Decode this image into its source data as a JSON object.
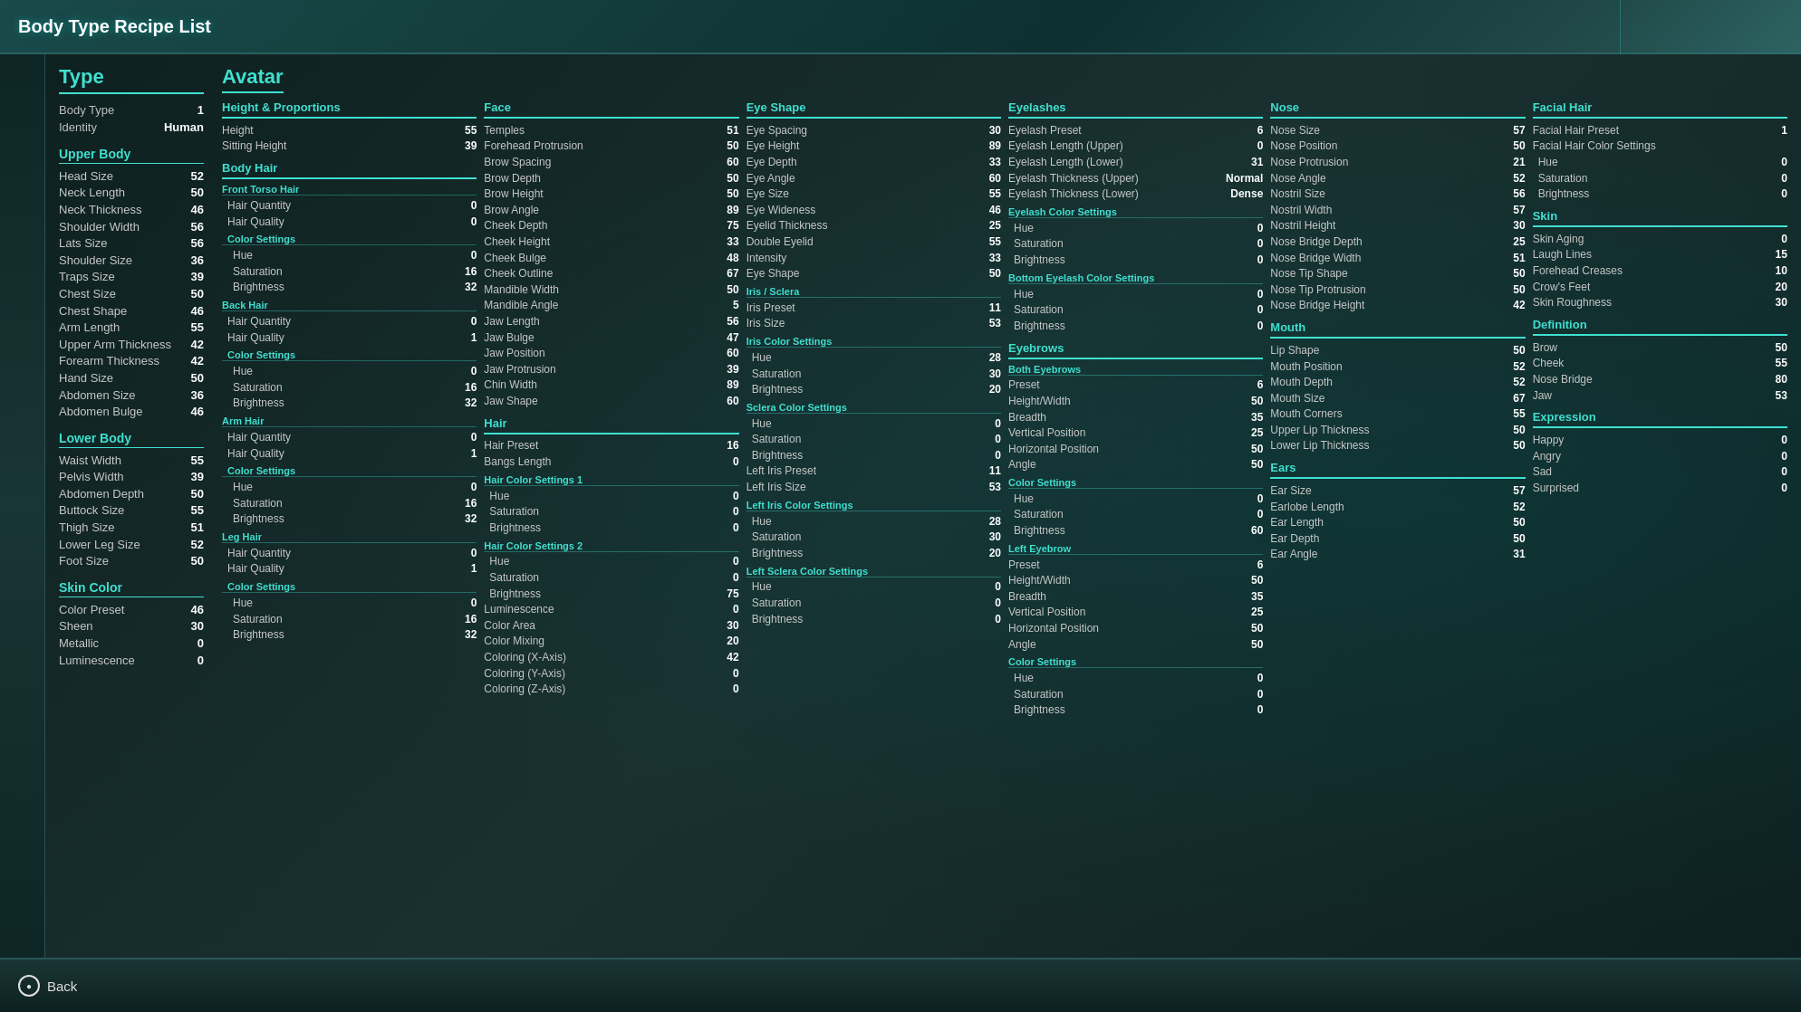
{
  "title": "Body Type Recipe List",
  "back_button": "Back",
  "type_section": {
    "title": "Type",
    "body_type_label": "Body Type",
    "body_type_value": "1",
    "identity_label": "Identity",
    "identity_value": "Human"
  },
  "avatar_title": "Avatar",
  "height_proportions": {
    "header": "Height & Proportions",
    "rows": [
      {
        "label": "Height",
        "value": "55"
      },
      {
        "label": "Sitting Height",
        "value": "39"
      }
    ]
  },
  "upper_body": {
    "header": "Upper Body",
    "rows": [
      {
        "label": "Head Size",
        "value": "52"
      },
      {
        "label": "Neck Length",
        "value": "50"
      },
      {
        "label": "Neck Thickness",
        "value": "46"
      },
      {
        "label": "Shoulder Width",
        "value": "56"
      },
      {
        "label": "Lats Size",
        "value": "56"
      },
      {
        "label": "Shoulder Size",
        "value": "36"
      },
      {
        "label": "Traps Size",
        "value": "39"
      },
      {
        "label": "Chest Size",
        "value": "50"
      },
      {
        "label": "Chest Shape",
        "value": "46"
      },
      {
        "label": "Arm Length",
        "value": "55"
      },
      {
        "label": "Upper Arm Thickness",
        "value": "42"
      },
      {
        "label": "Forearm Thickness",
        "value": "42"
      },
      {
        "label": "Hand Size",
        "value": "50"
      },
      {
        "label": "Abdomen Size",
        "value": "36"
      },
      {
        "label": "Abdomen Bulge",
        "value": "46"
      }
    ]
  },
  "lower_body": {
    "header": "Lower Body",
    "rows": [
      {
        "label": "Waist Width",
        "value": "55"
      },
      {
        "label": "Pelvis Width",
        "value": "39"
      },
      {
        "label": "Abdomen Depth",
        "value": "50"
      },
      {
        "label": "Buttock Size",
        "value": "55"
      },
      {
        "label": "Thigh Size",
        "value": "51"
      },
      {
        "label": "Lower Leg Size",
        "value": "52"
      },
      {
        "label": "Foot Size",
        "value": "50"
      }
    ]
  },
  "skin_color": {
    "header": "Skin Color",
    "rows": [
      {
        "label": "Color Preset",
        "value": "46"
      },
      {
        "label": "Sheen",
        "value": "30"
      },
      {
        "label": "Metallic",
        "value": "0"
      },
      {
        "label": "Luminescence",
        "value": "0"
      }
    ]
  },
  "body_hair": {
    "header": "Body Hair",
    "front_torso": {
      "label": "Front Torso Hair",
      "value": ""
    },
    "front_quantity": {
      "label": "Hair Quantity",
      "value": "0"
    },
    "front_quality": {
      "label": "Hair Quality",
      "value": "0"
    },
    "color_settings1": "Color Settings",
    "hue1": {
      "label": "Hue",
      "value": "0"
    },
    "sat1": {
      "label": "Saturation",
      "value": "16"
    },
    "bri1": {
      "label": "Brightness",
      "value": "32"
    },
    "back_hair": "Back Hair",
    "back_quantity": {
      "label": "Hair Quantity",
      "value": "0"
    },
    "back_quality": {
      "label": "Hair Quality",
      "value": "1"
    },
    "color_settings2": "Color Settings",
    "hue2": {
      "label": "Hue",
      "value": "0"
    },
    "sat2": {
      "label": "Saturation",
      "value": "16"
    },
    "bri2": {
      "label": "Brightness",
      "value": "32"
    },
    "arm_hair": "Arm Hair",
    "arm_quantity": {
      "label": "Hair Quantity",
      "value": "0"
    },
    "arm_quality": {
      "label": "Hair Quality",
      "value": "1"
    },
    "color_settings3": "Color Settings",
    "hue3": {
      "label": "Hue",
      "value": "0"
    },
    "sat3": {
      "label": "Saturation",
      "value": "16"
    },
    "bri3": {
      "label": "Brightness",
      "value": "32"
    },
    "leg_hair": "Leg Hair",
    "leg_quantity": {
      "label": "Hair Quantity",
      "value": "0"
    },
    "leg_quality": {
      "label": "Hair Quality",
      "value": "1"
    },
    "color_settings4": "Color Settings",
    "hue4": {
      "label": "Hue",
      "value": "0"
    },
    "sat4": {
      "label": "Saturation",
      "value": "16"
    },
    "bri4": {
      "label": "Brightness",
      "value": "32"
    }
  },
  "face": {
    "header": "Face",
    "rows": [
      {
        "label": "Temples",
        "value": "51"
      },
      {
        "label": "Forehead Protrusion",
        "value": "50"
      },
      {
        "label": "Brow Spacing",
        "value": "60"
      },
      {
        "label": "Brow Depth",
        "value": "50"
      },
      {
        "label": "Brow Height",
        "value": "50"
      },
      {
        "label": "Brow Angle",
        "value": "89"
      },
      {
        "label": "Cheek Depth",
        "value": "75"
      },
      {
        "label": "Cheek Height",
        "value": "33"
      },
      {
        "label": "Cheek Bulge",
        "value": "48"
      },
      {
        "label": "Cheek Outline",
        "value": "67"
      },
      {
        "label": "Mandible Width",
        "value": "50"
      },
      {
        "label": "Mandible Angle",
        "value": "5"
      },
      {
        "label": "Jaw Length",
        "value": "56"
      },
      {
        "label": "Jaw Bulge",
        "value": "47"
      },
      {
        "label": "Jaw Position",
        "value": "60"
      },
      {
        "label": "Jaw Protrusion",
        "value": "39"
      },
      {
        "label": "Chin Width",
        "value": "89"
      },
      {
        "label": "Jaw Shape",
        "value": "60"
      }
    ]
  },
  "hair": {
    "header": "Hair",
    "rows": [
      {
        "label": "Hair Preset",
        "value": "16"
      },
      {
        "label": "Bangs Length",
        "value": "0"
      }
    ],
    "color1": "Hair Color Settings 1",
    "hue1": {
      "label": "Hue",
      "value": "0"
    },
    "sat1": {
      "label": "Saturation",
      "value": "0"
    },
    "bri1": {
      "label": "Brightness",
      "value": "0"
    },
    "color2": "Hair Color Settings 2",
    "hue2": {
      "label": "Hue",
      "value": "0"
    },
    "sat2": {
      "label": "Saturation",
      "value": "0"
    },
    "bri2": {
      "label": "Brightness",
      "value": "75"
    },
    "luminescence": {
      "label": "Luminescence",
      "value": "0"
    },
    "color_area": {
      "label": "Color Area",
      "value": "30"
    },
    "color_mixing": {
      "label": "Color Mixing",
      "value": "20"
    },
    "coloring_x": {
      "label": "Coloring (X-Axis)",
      "value": "42"
    },
    "coloring_y": {
      "label": "Coloring (Y-Axis)",
      "value": "0"
    },
    "coloring_z": {
      "label": "Coloring (Z-Axis)",
      "value": "0"
    }
  },
  "eye_shape": {
    "header": "Eye Shape",
    "rows": [
      {
        "label": "Eye Spacing",
        "value": "30"
      },
      {
        "label": "Eye Height",
        "value": "89"
      },
      {
        "label": "Eye Depth",
        "value": "33"
      },
      {
        "label": "Eye Angle",
        "value": "60"
      },
      {
        "label": "Eye Size",
        "value": "55"
      },
      {
        "label": "Eye Wideness",
        "value": "46"
      },
      {
        "label": "Eyelid Thickness",
        "value": "25"
      },
      {
        "label": "Double Eyelid",
        "value": "55"
      },
      {
        "label": "Intensity",
        "value": "33"
      },
      {
        "label": "Eye Shape",
        "value": "50"
      }
    ],
    "iris_sclera": "Iris / Sclera",
    "iris_rows": [
      {
        "label": "Iris Preset",
        "value": "11"
      },
      {
        "label": "Iris Size",
        "value": "53"
      }
    ],
    "iris_color": "Iris Color Settings",
    "iris_color_rows": [
      {
        "label": "Hue",
        "value": "28"
      },
      {
        "label": "Saturation",
        "value": "30"
      },
      {
        "label": "Brightness",
        "value": "20"
      }
    ],
    "sclera_color": "Sclera Color Settings",
    "sclera_rows": [
      {
        "label": "Hue",
        "value": "0"
      },
      {
        "label": "Saturation",
        "value": "0"
      },
      {
        "label": "Brightness",
        "value": "0"
      }
    ],
    "left_iris": {
      "label": "Left Iris Preset",
      "value": "11"
    },
    "left_iris_size": {
      "label": "Left Iris Size",
      "value": "53"
    },
    "left_iris_color": "Left Iris Color Settings",
    "left_iris_hue": {
      "label": "Hue",
      "value": "28"
    },
    "left_iris_sat": {
      "label": "Saturation",
      "value": "30"
    },
    "left_iris_bri": {
      "label": "Brightness",
      "value": "20"
    },
    "left_sclera": "Left Sclera Color Settings",
    "left_sclera_hue": {
      "label": "Hue",
      "value": "0"
    },
    "left_sclera_sat": {
      "label": "Saturation",
      "value": "0"
    },
    "left_sclera_bri": {
      "label": "Brightness",
      "value": "0"
    }
  },
  "eyelashes": {
    "header": "Eyelashes",
    "rows": [
      {
        "label": "Eyelash Preset",
        "value": "6"
      },
      {
        "label": "Eyelash Length (Upper)",
        "value": "0"
      },
      {
        "label": "Eyelash Length (Lower)",
        "value": "31"
      },
      {
        "label": "Eyelash Thickness (Upper)",
        "value": "Normal"
      },
      {
        "label": "Eyelash Thickness (Lower)",
        "value": "Dense"
      }
    ],
    "eyelash_color": "Eyelash Color Settings",
    "eyelash_color_rows": [
      {
        "label": "Hue",
        "value": "0"
      },
      {
        "label": "Saturation",
        "value": "0"
      },
      {
        "label": "Brightness",
        "value": "0"
      }
    ],
    "bottom_color": "Bottom Eyelash Color Settings",
    "bottom_rows": [
      {
        "label": "Hue",
        "value": "0"
      },
      {
        "label": "Saturation",
        "value": "0"
      },
      {
        "label": "Brightness",
        "value": "0"
      }
    ]
  },
  "eyebrows": {
    "header": "Eyebrows",
    "both_label": "Both Eyebrows",
    "rows": [
      {
        "label": "Preset",
        "value": "6"
      },
      {
        "label": "Height/Width",
        "value": "50"
      },
      {
        "label": "Breadth",
        "value": "35"
      },
      {
        "label": "Vertical Position",
        "value": "25"
      },
      {
        "label": "Horizontal Position",
        "value": "50"
      },
      {
        "label": "Angle",
        "value": "50"
      }
    ],
    "color": "Color Settings",
    "color_rows": [
      {
        "label": "Hue",
        "value": "0"
      },
      {
        "label": "Saturation",
        "value": "0"
      },
      {
        "label": "Brightness",
        "value": "60"
      }
    ],
    "left_label": "Left Eyebrow",
    "left_rows": [
      {
        "label": "Preset",
        "value": "6"
      },
      {
        "label": "Height/Width",
        "value": "50"
      },
      {
        "label": "Breadth",
        "value": "35"
      },
      {
        "label": "Vertical Position",
        "value": "25"
      },
      {
        "label": "Horizontal Position",
        "value": "50"
      },
      {
        "label": "Angle",
        "value": "50"
      }
    ],
    "left_color": "Color Settings",
    "left_color_rows": [
      {
        "label": "Hue",
        "value": "0"
      },
      {
        "label": "Saturation",
        "value": "0"
      },
      {
        "label": "Brightness",
        "value": "0"
      }
    ]
  },
  "nose": {
    "header": "Nose",
    "rows": [
      {
        "label": "Nose Size",
        "value": "57"
      },
      {
        "label": "Nose Position",
        "value": "50"
      },
      {
        "label": "Nose Protrusion",
        "value": "21"
      },
      {
        "label": "Nose Angle",
        "value": "52"
      },
      {
        "label": "Nostril Size",
        "value": "56"
      },
      {
        "label": "Nostril Width",
        "value": "57"
      },
      {
        "label": "Nostril Height",
        "value": "30"
      },
      {
        "label": "Nose Bridge Depth",
        "value": "25"
      },
      {
        "label": "Nose Bridge Width",
        "value": "51"
      },
      {
        "label": "Nose Tip Shape",
        "value": "50"
      },
      {
        "label": "Nose Tip Protrusion",
        "value": "50"
      },
      {
        "label": "Nose Bridge Height",
        "value": "42"
      }
    ]
  },
  "mouth": {
    "header": "Mouth",
    "rows": [
      {
        "label": "Lip Shape",
        "value": "50"
      },
      {
        "label": "Mouth Position",
        "value": "52"
      },
      {
        "label": "Mouth Depth",
        "value": "52"
      },
      {
        "label": "Mouth Size",
        "value": "67"
      },
      {
        "label": "Mouth Corners",
        "value": "55"
      },
      {
        "label": "Upper Lip Thickness",
        "value": "50"
      },
      {
        "label": "Lower Lip Thickness",
        "value": "50"
      }
    ]
  },
  "ears": {
    "header": "Ears",
    "rows": [
      {
        "label": "Ear Size",
        "value": "57"
      },
      {
        "label": "Earlobe Length",
        "value": "52"
      },
      {
        "label": "Ear Length",
        "value": "50"
      },
      {
        "label": "Ear Depth",
        "value": "50"
      },
      {
        "label": "Ear Angle",
        "value": "31"
      }
    ]
  },
  "facial_hair": {
    "header": "Facial Hair",
    "rows": [
      {
        "label": "Facial Hair Preset",
        "value": "1"
      },
      {
        "label": "Facial Hair Color Settings",
        "value": ""
      }
    ],
    "hue": {
      "label": "Hue",
      "value": "0"
    },
    "sat": {
      "label": "Saturation",
      "value": "0"
    },
    "bri": {
      "label": "Brightness",
      "value": "0"
    }
  },
  "skin": {
    "header": "Skin",
    "rows": [
      {
        "label": "Skin Aging",
        "value": "0"
      },
      {
        "label": "Laugh Lines",
        "value": "15"
      },
      {
        "label": "Forehead Creases",
        "value": "10"
      },
      {
        "label": "Crow's Feet",
        "value": "20"
      },
      {
        "label": "Skin Roughness",
        "value": "30"
      }
    ]
  },
  "definition": {
    "header": "Definition",
    "rows": [
      {
        "label": "Brow",
        "value": "50"
      },
      {
        "label": "Cheek",
        "value": "55"
      },
      {
        "label": "Nose Bridge",
        "value": "80"
      },
      {
        "label": "Jaw",
        "value": "53"
      }
    ]
  },
  "expression": {
    "header": "Expression",
    "rows": [
      {
        "label": "Happy",
        "value": "0"
      },
      {
        "label": "Angry",
        "value": "0"
      },
      {
        "label": "Sad",
        "value": "0"
      },
      {
        "label": "Surprised",
        "value": "0"
      }
    ]
  },
  "brightness_preset_panel": {
    "brightness_20": "Brightness 20",
    "preset_label": "Preset",
    "brightness_label": "Brightness",
    "left_eyebrow_label": "Left Eyebrow"
  }
}
